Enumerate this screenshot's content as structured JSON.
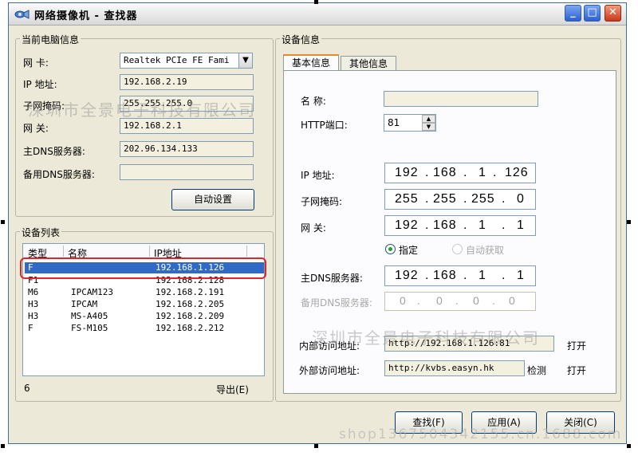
{
  "window": {
    "title": "网络摄像机 - 查找器"
  },
  "titlebar_buttons": {
    "minimize": "_",
    "maximize": "□",
    "close": "✕"
  },
  "pc_info": {
    "title": "当前电脑信息",
    "network_card_label": "网   卡:",
    "network_card_value": "Realtek PCIe FE Fami",
    "ip_label": "IP   地址:",
    "ip_value": "192.168.2.19",
    "subnet_label": "子网掩码:",
    "subnet_value": "255.255.255.0",
    "gateway_label": "网    关:",
    "gateway_value": "192.168.2.1",
    "dns_label": "主DNS服务器:",
    "dns_value": "202.96.134.133",
    "dns2_label": "备用DNS服务器:",
    "dns2_value": "",
    "auto_button": "自动设置"
  },
  "device_list": {
    "title": "设备列表",
    "columns": [
      "类型",
      "名称",
      "IP地址"
    ],
    "rows": [
      {
        "type": "F",
        "name": "",
        "ip": "192.168.1.126",
        "selected": true
      },
      {
        "type": "F1",
        "name": "",
        "ip": "192.168.2.128"
      },
      {
        "type": "M6",
        "name": "IPCAM123",
        "ip": "192.168.2.191"
      },
      {
        "type": "H3",
        "name": "IPCAM",
        "ip": "192.168.2.205"
      },
      {
        "type": "H3",
        "name": "MS-A405",
        "ip": "192.168.2.209"
      },
      {
        "type": "F",
        "name": "FS-M105",
        "ip": "192.168.2.212"
      }
    ],
    "count": "6",
    "export_button": "导出(E)"
  },
  "device_info": {
    "title": "设备信息",
    "tabs": [
      "基本信息",
      "其他信息"
    ],
    "name_label": "名   称:",
    "name_value": "",
    "http_port_label": "HTTP端口:",
    "http_port_value": "81",
    "ip_label": "IP  地址:",
    "ip_octets": [
      "192",
      "168",
      "1",
      "126"
    ],
    "subnet_label": "子网掩码:",
    "subnet_octets": [
      "255",
      "255",
      "255",
      "0"
    ],
    "gateway_label": "网    关:",
    "gateway_octets": [
      "192",
      "168",
      "1",
      "1"
    ],
    "radio_specified": "指定",
    "radio_auto": "自动获取",
    "dns_label": "主DNS服务器:",
    "dns_octets": [
      "192",
      "168",
      "1",
      "1"
    ],
    "dns2_label": "备用DNS服务器:",
    "dns2_octets": [
      "0",
      "0",
      "0",
      "0"
    ],
    "internal_label": "内部访问地址:",
    "internal_value": "http://192.168.1.126:81",
    "internal_open": "打开",
    "external_label": "外部访问地址:",
    "external_value": "http://kvbs.easyn.hk",
    "external_check": "检测",
    "external_open": "打开"
  },
  "footer": {
    "find_button": "查找(F)",
    "apply_button": "应用(A)",
    "close_button": "关闭(C)"
  },
  "watermarks": {
    "left": "深圳市全景电子科技有限公司",
    "right": "深圳市全景电子科技有限公司",
    "bottom": "shop1367504342155.cn.1688.com"
  },
  "colors": {
    "selection": "#316ac5",
    "highlight_border": "#e0262a",
    "title_bar_blue": "#3a6ea5"
  }
}
